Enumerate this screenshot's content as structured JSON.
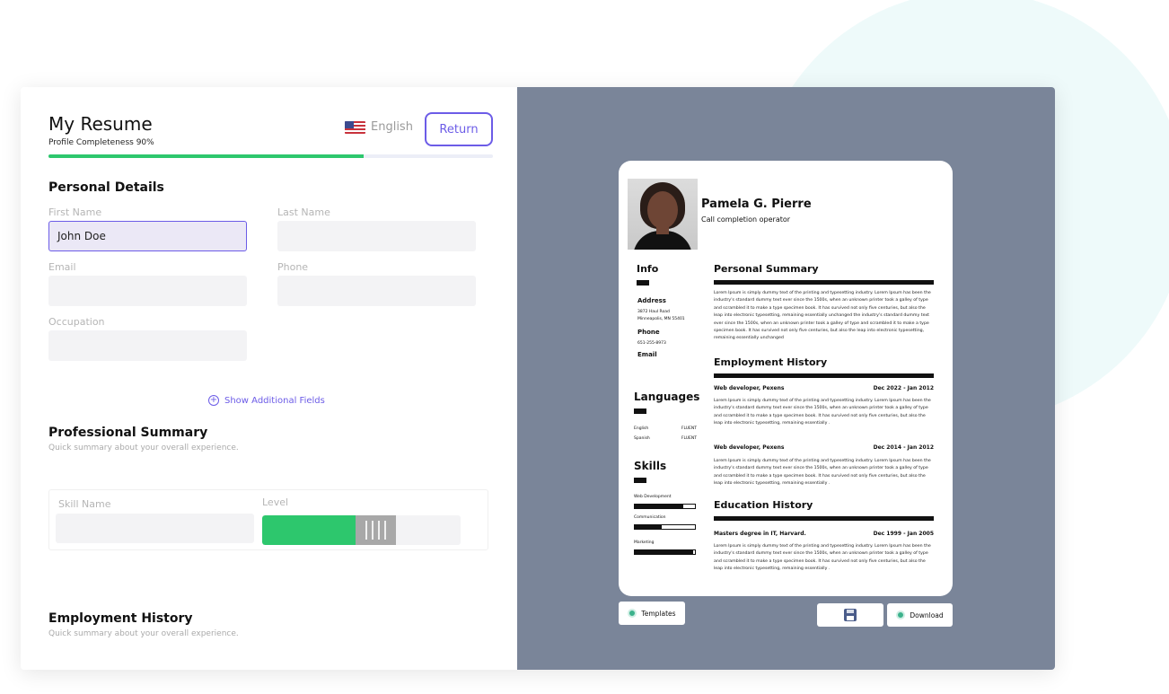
{
  "editor": {
    "title": "My Resume",
    "completeness_label": "Profile Completeness 90%",
    "completeness": 0.71,
    "language": "English",
    "return_label": "Return",
    "personal_details": {
      "heading": "Personal Details",
      "first_name_label": "First Name",
      "first_name_value": "John Doe",
      "last_name_label": "Last Name",
      "email_label": "Email",
      "phone_label": "Phone",
      "occupation_label": "Occupation",
      "show_more": "Show Additional Fields"
    },
    "professional_summary": {
      "heading": "Professional Summary",
      "subtitle": "Quick summary about your overall experience.",
      "skill_name_label": "Skill Name",
      "level_label": "Level",
      "level": 0.47
    },
    "employment_history": {
      "heading": "Employment History",
      "subtitle": "Quick summary about your overall experience."
    }
  },
  "resume": {
    "name": "Pamela G. Pierre",
    "title": "Call completion operator",
    "info_heading": "Info",
    "address_label": "Address",
    "address_line1": "3872 Haul Road",
    "address_line2": "Minneapolis, MN 55401",
    "phone_label": "Phone",
    "phone_value": "651-255-8973",
    "email_label": "Email",
    "languages_heading": "Languages",
    "languages": [
      {
        "name": "English",
        "level": "FLUENT"
      },
      {
        "name": "Spanish",
        "level": "FLUENT"
      }
    ],
    "skills_heading": "Skills",
    "skills": [
      {
        "name": "Web Development",
        "level": 0.8
      },
      {
        "name": "Communication",
        "level": 0.45
      },
      {
        "name": "Marketing",
        "level": 0.97
      }
    ],
    "personal_summary_heading": "Personal Summary",
    "personal_summary_text": "Lorem Ipsum is simply dummy text of the printing and typesetting industry. Lorem Ipsum has been the industry's standard dummy text ever since the 1500s, when an unknown printer took a galley of type and scrambled it to make a type specimen book. It has survived not only five centuries, but also the leap into electronic typesetting, remaining essentially unchanged the industry's standard dummy text ever since the 1500s, when an unknown printer took a galley of type and scrambled it to make a type specimen book. It has survived not only five centuries, but also the leap into electronic typesetting, remaining essentially unchanged",
    "employment_heading": "Employment History",
    "jobs": [
      {
        "role": "Web developer, Pexens",
        "dates": "Dec 2022 - Jan 2012",
        "text": "Lorem Ipsum is simply dummy text of the printing and typesetting industry. Lorem Ipsum has been the industry's standard dummy text ever since the 1500s, when an unknown printer took a galley of type and scrambled it to make a type specimen book. It has survived not only five centuries, but also the leap into electronic typesetting, remaining essentially ."
      },
      {
        "role": "Web developer, Pexens",
        "dates": "Dec 2014 - Jan 2012",
        "text": "Lorem Ipsum is simply dummy text of the printing and typesetting industry. Lorem Ipsum has been the industry's standard dummy text ever since the 1500s, when an unknown printer took a galley of type and scrambled it to make a type specimen book. It has survived not only five centuries, but also the leap into electronic typesetting, remaining essentially ."
      }
    ],
    "education_heading": "Education History",
    "education": [
      {
        "degree": "Masters degree in IT, Harvard.",
        "dates": "Dec 1999 - Jan 2005",
        "text": "Lorem Ipsum is simply dummy text of the printing and typesetting industry. Lorem Ipsum has been the industry's standard dummy text ever since the 1500s, when an unknown printer took a galley of type and scrambled it to make a type specimen book. It has survived not only five centuries, but also the leap into electronic typesetting, remaining essentially ."
      }
    ]
  },
  "preview_toolbar": {
    "templates_label": "Templates",
    "download_label": "Download"
  },
  "colors": {
    "accent": "#6c5ce7",
    "progress": "#2dc76d",
    "preview_bg": "#7a8599"
  }
}
